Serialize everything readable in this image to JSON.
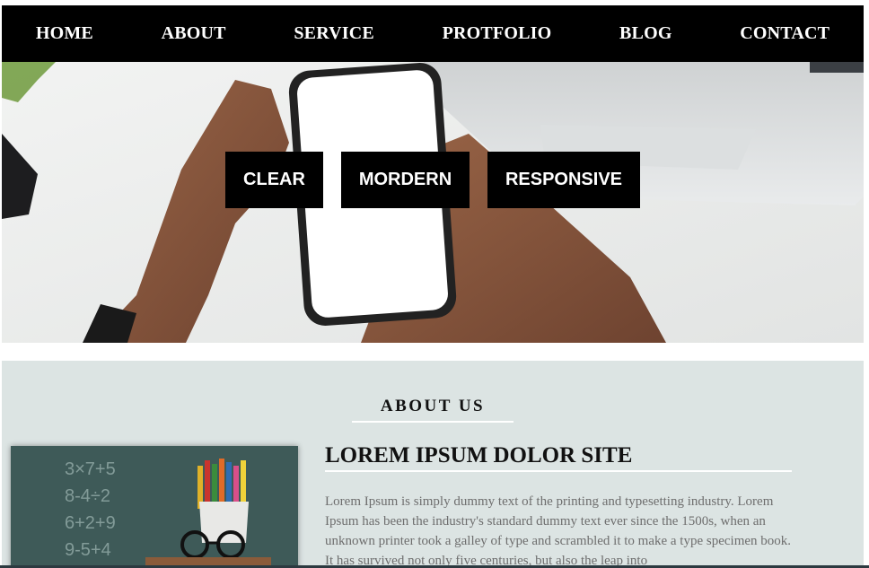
{
  "nav": {
    "items": [
      {
        "label": "HOME"
      },
      {
        "label": "ABOUT"
      },
      {
        "label": "SERVICE"
      },
      {
        "label": "PROTFOLIO"
      },
      {
        "label": "BLOG"
      },
      {
        "label": "CONTACT"
      }
    ]
  },
  "hero": {
    "buttons": [
      {
        "label": "CLEAR"
      },
      {
        "label": "MORDERN"
      },
      {
        "label": "RESPONSIVE"
      }
    ]
  },
  "about": {
    "heading": "ABOUT US",
    "title": "LOREM IPSUM DOLOR SITE",
    "paragraph": "Lorem Ipsum is simply dummy text of the printing and typesetting industry. Lorem Ipsum has been the industry's standard dummy text ever since the 1500s, when an unknown printer took a galley of type and scrambled it to make a type specimen book. It has survived not only five centuries, but also the leap into",
    "chalkboard_text": [
      "3×7+5",
      "8-4÷2",
      "6+2+9",
      "9-5+4"
    ]
  }
}
